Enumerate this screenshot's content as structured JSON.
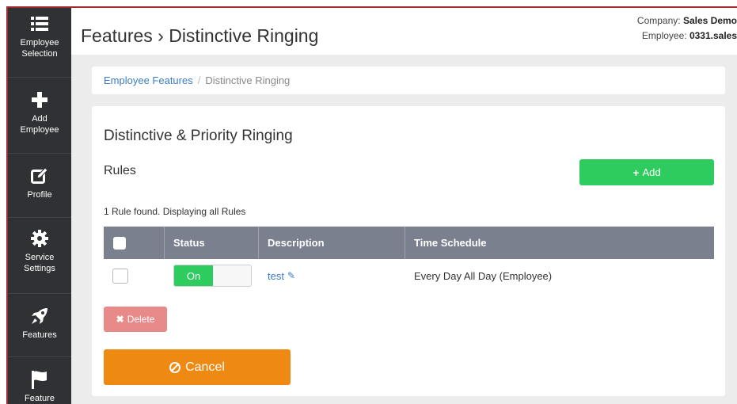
{
  "sidebar": {
    "items": [
      {
        "label_line1": "Employee",
        "label_line2": "Selection",
        "icon": "list-icon"
      },
      {
        "label_line1": "Add",
        "label_line2": "Employee",
        "icon": "plus-icon"
      },
      {
        "label_line1": "Profile",
        "label_line2": "",
        "icon": "edit-icon"
      },
      {
        "label_line1": "Service",
        "label_line2": "Settings",
        "icon": "gear-icon"
      },
      {
        "label_line1": "Features",
        "label_line2": "",
        "icon": "rocket-icon"
      },
      {
        "label_line1": "Feature",
        "label_line2": "",
        "icon": "flag-icon"
      }
    ]
  },
  "header": {
    "title": "Features › Distinctive Ringing",
    "company_label": "Company:",
    "company_value": "Sales Demo",
    "employee_label": "Employee:",
    "employee_value": "0331.sales"
  },
  "breadcrumb": {
    "link": "Employee Features",
    "separator": "/",
    "current": "Distinctive Ringing"
  },
  "panel": {
    "title": "Distinctive & Priority Ringing",
    "rules_title": "Rules",
    "add_label": "Add",
    "count_text": "1 Rule found. Displaying all Rules",
    "delete_label": "Delete",
    "cancel_label": "Cancel"
  },
  "table": {
    "headers": {
      "status": "Status",
      "description": "Description",
      "time_schedule": "Time Schedule"
    },
    "rows": [
      {
        "status": "On",
        "description": "test",
        "time_schedule": "Every Day All Day (Employee)"
      }
    ]
  },
  "colors": {
    "sidebar": "#2f3135",
    "add_button": "#2ecc5f",
    "delete_button": "#e98a8a",
    "cancel_button": "#ee8a12",
    "link": "#3b7dc4",
    "table_header": "#7a808d"
  }
}
